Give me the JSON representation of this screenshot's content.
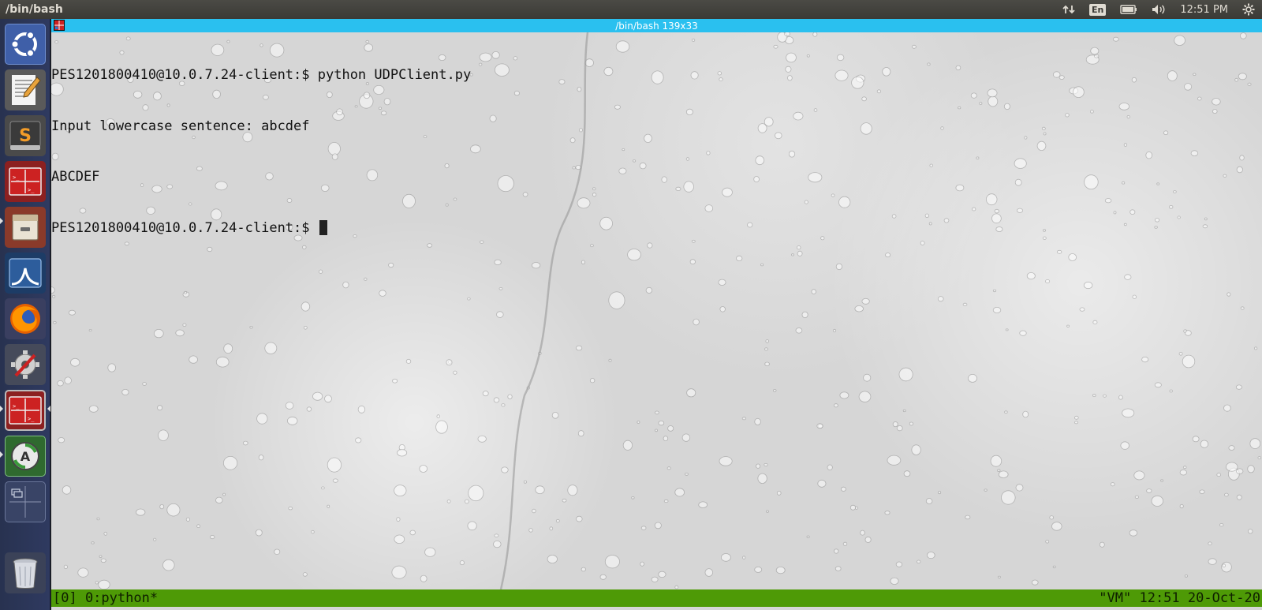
{
  "panel": {
    "title": "/bin/bash",
    "keyboard_layout": "En",
    "clock": "12:51 PM"
  },
  "launcher": {
    "items": [
      {
        "name": "ubuntu-dash",
        "icon": "ubuntu-logo-icon"
      },
      {
        "name": "text-editor",
        "icon": "text-editor-icon"
      },
      {
        "name": "sublime-text",
        "icon": "sublime-text-icon"
      },
      {
        "name": "terminal",
        "icon": "terminal-icon"
      },
      {
        "name": "files",
        "icon": "file-cabinet-icon"
      },
      {
        "name": "wireshark",
        "icon": "wireshark-fin-icon"
      },
      {
        "name": "firefox",
        "icon": "firefox-icon"
      },
      {
        "name": "system-settings",
        "icon": "gear-wrench-icon"
      },
      {
        "name": "terminal-active",
        "icon": "terminal-icon"
      },
      {
        "name": "software-updater",
        "icon": "software-updater-icon"
      },
      {
        "name": "workspace-switcher",
        "icon": "workspace-switcher-icon"
      },
      {
        "name": "trash",
        "icon": "trash-icon"
      }
    ]
  },
  "terminal": {
    "window_title": "/bin/bash 139x33",
    "lines": [
      "PES1201800410@10.0.7.24-client:$ python UDPClient.py",
      "Input lowercase sentence: abcdef",
      "ABCDEF",
      "PES1201800410@10.0.7.24-client:$ "
    ]
  },
  "tmux_status": {
    "left": "[0] 0:python*",
    "right": "\"VM\" 12:51 20-Oct-20"
  },
  "colors": {
    "panel_bg": "#3b3a36",
    "titlebar": "#2ac0ef",
    "status_bar": "#4e9a06",
    "launcher_bg": "#2b3455"
  }
}
